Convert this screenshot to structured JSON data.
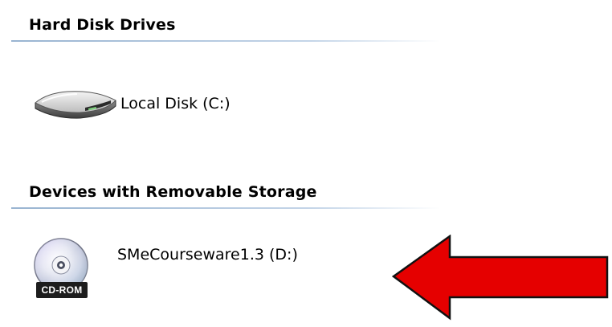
{
  "colors": {
    "accent_line": "#99b4d1",
    "arrow_fill": "#e50000",
    "arrow_stroke": "#111111"
  },
  "groups": [
    {
      "header": "Hard Disk Drives",
      "items": [
        {
          "label": "Local Disk (C:)",
          "icon": "hard-drive-icon"
        }
      ]
    },
    {
      "header": "Devices with Removable Storage",
      "items": [
        {
          "label": "SMeCourseware1.3 (D:)",
          "icon": "cd-rom-icon",
          "badge": "CD-ROM"
        }
      ]
    }
  ],
  "annotation": {
    "icon": "red-arrow-icon"
  }
}
